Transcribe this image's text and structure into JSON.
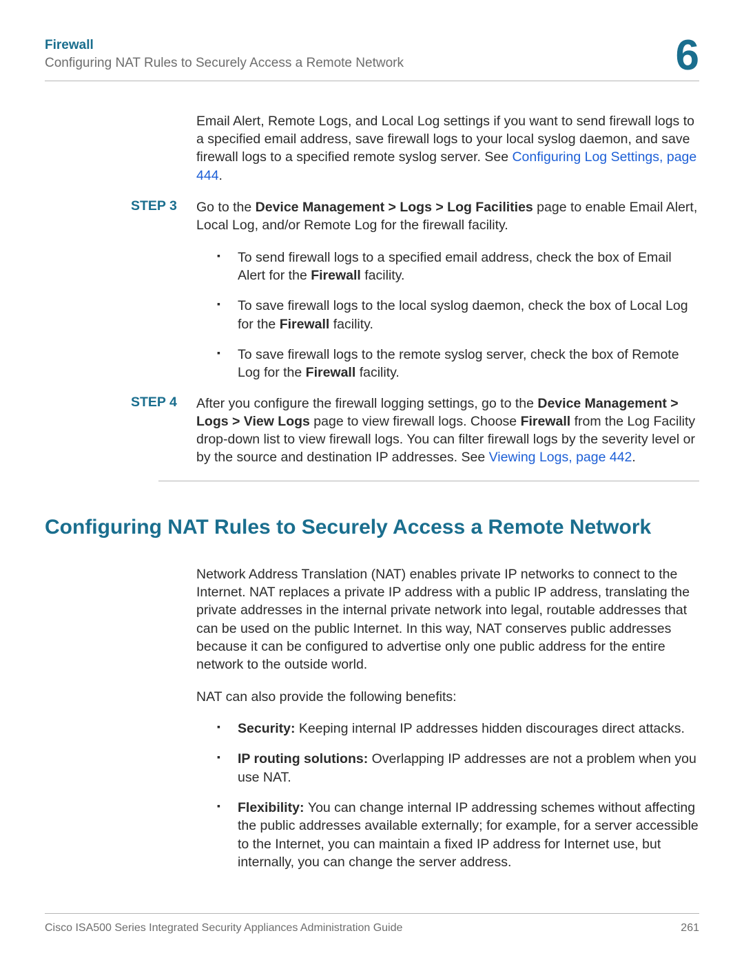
{
  "header": {
    "title": "Firewall",
    "subtitle": "Configuring NAT Rules to Securely Access a Remote Network",
    "chapter": "6"
  },
  "intro_para_1": "Email Alert, Remote Logs, and Local Log settings if you want to send firewall logs to a specified email address, save firewall logs to your local syslog daemon, and save firewall logs to a specified remote syslog server. See ",
  "intro_link": "Configuring Log Settings, page 444",
  "step3": {
    "label": "STEP 3",
    "text_pre": "Go to the ",
    "bold1": "Device Management > Logs > Log Facilities",
    "text_post": " page to enable Email Alert, Local Log, and/or Remote Log for the firewall facility.",
    "bullets": {
      "b1_pre": "To send firewall logs to a specified email address, check the box of Email Alert for the ",
      "b1_bold": "Firewall",
      "b1_post": " facility.",
      "b2_pre": "To save firewall logs to the local syslog daemon, check the box of Local Log for the ",
      "b2_bold": "Firewall",
      "b2_post": " facility.",
      "b3_pre": "To save firewall logs to the remote syslog server, check the box of Remote Log for the ",
      "b3_bold": "Firewall",
      "b3_post": " facility."
    }
  },
  "step4": {
    "label": "STEP 4",
    "t1": "After you configure the firewall logging settings, go to the ",
    "b1": "Device Management > Logs > View Logs",
    "t2": " page to view firewall logs. Choose ",
    "b2": "Firewall",
    "t3": " from the Log Facility drop-down list to view firewall logs. You can filter firewall logs by the severity level or by the source and destination IP addresses. See ",
    "link": "Viewing Logs, page 442",
    "t4": "."
  },
  "section": {
    "heading": "Configuring NAT Rules to Securely Access a Remote Network",
    "para1": "Network Address Translation (NAT) enables private IP networks to connect to the Internet. NAT replaces a private IP address with a public IP address, translating the private addresses in the internal private network into legal, routable addresses that can be used on the public Internet. In this way, NAT conserves public addresses because it can be configured to advertise only one public address for the entire network to the outside world.",
    "para2": "NAT can also provide the following benefits:",
    "bullets": {
      "b1_bold": "Security: ",
      "b1_text": "Keeping internal IP addresses hidden discourages direct attacks.",
      "b2_bold": "IP routing solutions: ",
      "b2_text": "Overlapping IP addresses are not a problem when you use NAT.",
      "b3_bold": "Flexibility: ",
      "b3_text": "You can change internal IP addressing schemes without affecting the public addresses available externally; for example, for a server accessible to the Internet, you can maintain a fixed IP address for Internet use, but internally, you can change the server address."
    }
  },
  "footer": {
    "guide": "Cisco ISA500 Series Integrated Security Appliances Administration Guide",
    "page": "261"
  }
}
